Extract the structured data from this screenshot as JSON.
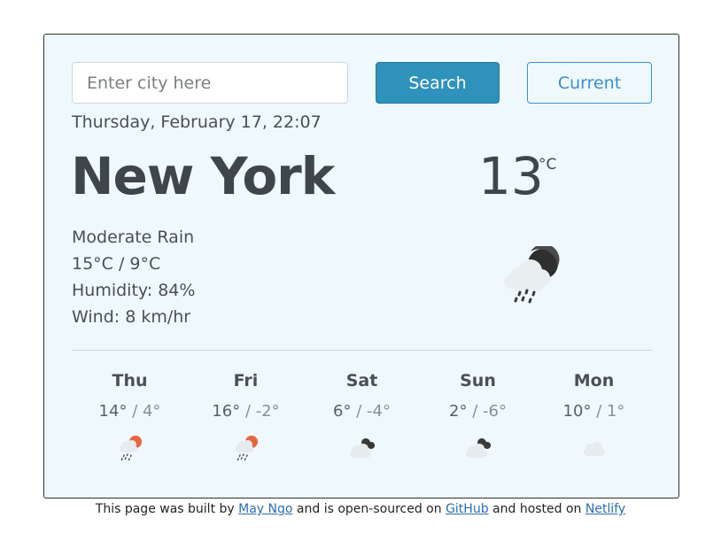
{
  "search": {
    "placeholder": "Enter city here",
    "button_label": "Search",
    "current_label": "Current"
  },
  "current": {
    "date": "Thursday, February 17, 22:07",
    "city": "New York",
    "temperature": "13",
    "unit": "°C",
    "description": "Moderate Rain",
    "high_low": "15°C / 9°C",
    "humidity": "Humidity: 84%",
    "wind": "Wind: 8 km/hr",
    "icon": "night-cloud-rain-icon"
  },
  "forecast": [
    {
      "day": "Thu",
      "high": "14°",
      "low": "4°",
      "icon": "day-cloud-rain-icon"
    },
    {
      "day": "Fri",
      "high": "16°",
      "low": "-2°",
      "icon": "day-cloud-rain-icon"
    },
    {
      "day": "Sat",
      "high": "6°",
      "low": "-4°",
      "icon": "night-cloudy-icon"
    },
    {
      "day": "Sun",
      "high": "2°",
      "low": "-6°",
      "icon": "night-cloudy-icon"
    },
    {
      "day": "Mon",
      "high": "10°",
      "low": "1°",
      "icon": "cloud-icon"
    }
  ],
  "footer": {
    "prefix": "This page was built by ",
    "author": "May Ngo",
    "middle": " and is open-sourced on ",
    "github": "GitHub",
    "middle2": " and hosted on ",
    "netlify": "Netlify"
  },
  "colors": {
    "card_background": "#eff9fd",
    "search_button": "#2e92bb",
    "current_button_text": "#3a8dd3",
    "sun_accent": "#e8653f"
  }
}
